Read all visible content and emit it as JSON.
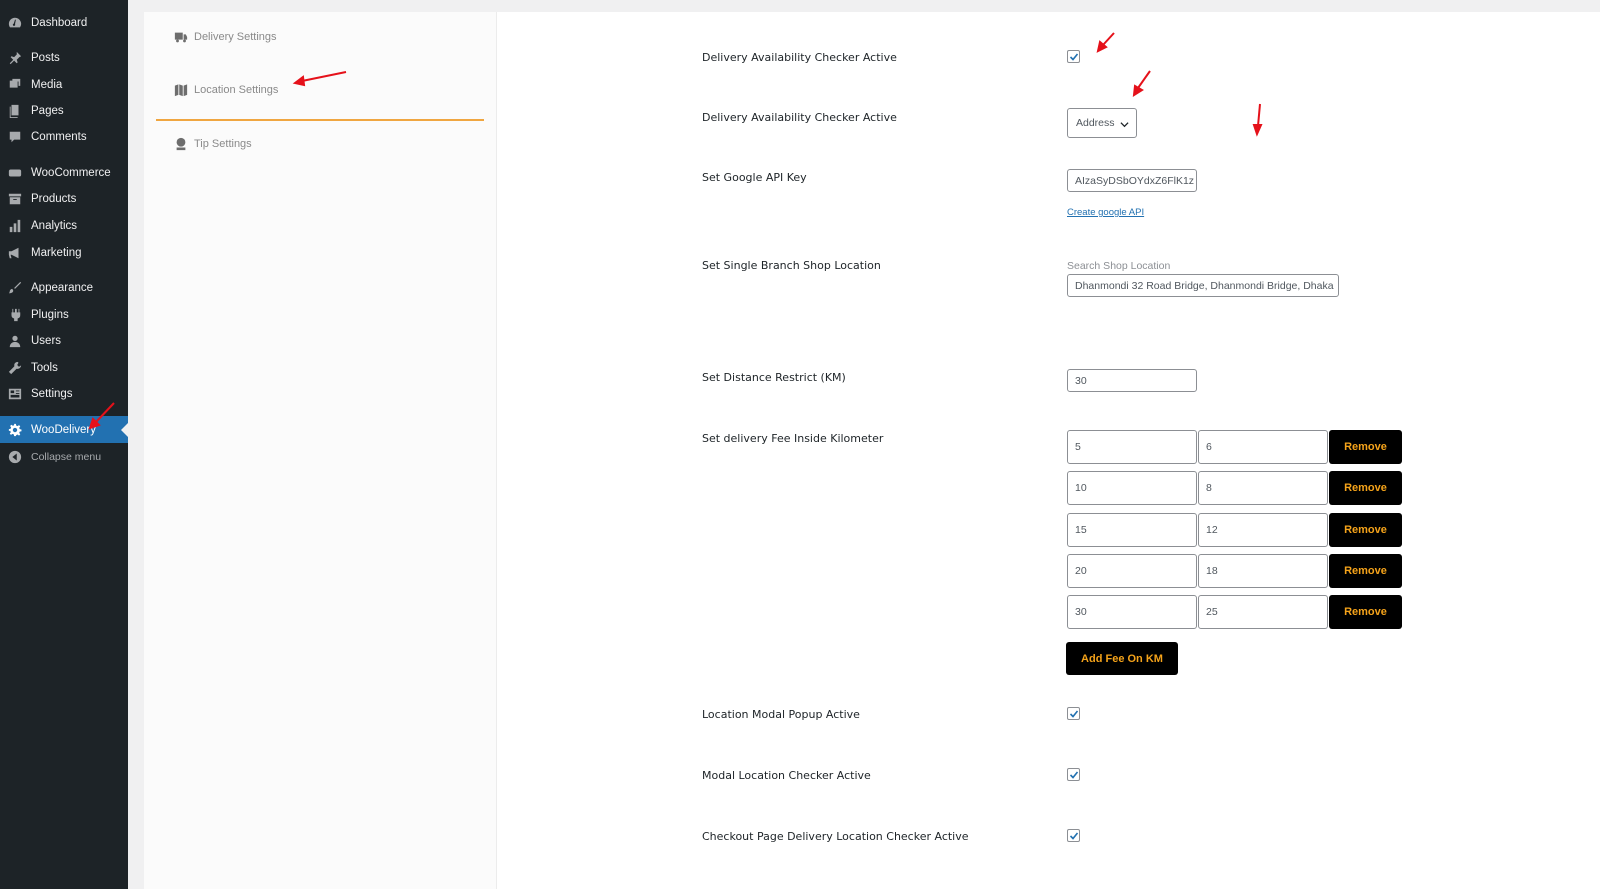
{
  "sidebar": {
    "items": [
      {
        "label": "Dashboard",
        "icon": "dashboard-icon"
      },
      {
        "label": "Posts",
        "icon": "pin-icon"
      },
      {
        "label": "Media",
        "icon": "media-icon"
      },
      {
        "label": "Pages",
        "icon": "pages-icon"
      },
      {
        "label": "Comments",
        "icon": "comment-icon"
      },
      {
        "label": "WooCommerce",
        "icon": "woo-icon"
      },
      {
        "label": "Products",
        "icon": "archive-icon"
      },
      {
        "label": "Analytics",
        "icon": "bar-chart-icon"
      },
      {
        "label": "Marketing",
        "icon": "megaphone-icon"
      },
      {
        "label": "Appearance",
        "icon": "brush-icon"
      },
      {
        "label": "Plugins",
        "icon": "plug-icon"
      },
      {
        "label": "Users",
        "icon": "user-icon"
      },
      {
        "label": "Tools",
        "icon": "wrench-icon"
      },
      {
        "label": "Settings",
        "icon": "settings-icon"
      },
      {
        "label": "WooDelivery",
        "icon": "gear-icon",
        "current": true
      }
    ],
    "collapse_label": "Collapse menu"
  },
  "tabs": [
    {
      "label": "Delivery Settings",
      "icon": "truck-icon"
    },
    {
      "label": "Location Settings",
      "icon": "map-icon",
      "active": true
    },
    {
      "label": "Tip Settings",
      "icon": "tip-icon"
    }
  ],
  "form": {
    "availability_checker_label": "Delivery Availability Checker Active",
    "availability_checker_checked": true,
    "availability_type_label": "Delivery Availability Checker Active",
    "availability_type_value": "Address",
    "api_key_label": "Set Google API Key",
    "api_key_value": "AIzaSyDSbOYdxZ6FlK1z",
    "api_link": "Create google API",
    "shop_location_label": "Set Single Branch Shop Location",
    "shop_location_hint": "Search Shop Location",
    "shop_location_value": "Dhanmondi 32 Road Bridge, Dhanmondi Bridge, Dhaka",
    "distance_label": "Set Distance Restrict (KM)",
    "distance_value": "30",
    "fee_label": "Set delivery Fee Inside Kilometer",
    "fee_rows": [
      {
        "km": "5",
        "fee": "6"
      },
      {
        "km": "10",
        "fee": "8"
      },
      {
        "km": "15",
        "fee": "12"
      },
      {
        "km": "20",
        "fee": "18"
      },
      {
        "km": "30",
        "fee": "25"
      }
    ],
    "remove_label": "Remove",
    "add_fee_label": "Add Fee On KM",
    "modal_popup_label": "Location Modal Popup Active",
    "modal_popup_checked": true,
    "modal_checker_label": "Modal Location Checker Active",
    "modal_checker_checked": true,
    "checkout_checker_label": "Checkout Page Delivery Location Checker Active",
    "checkout_checker_checked": true
  },
  "colors": {
    "sidebar_bg": "#1d2327",
    "accent": "#2271b1",
    "button_bg": "#000000",
    "button_text": "#f5a31a",
    "tab_underline": "#f0a640",
    "annotation_arrow": "#e5111a"
  }
}
